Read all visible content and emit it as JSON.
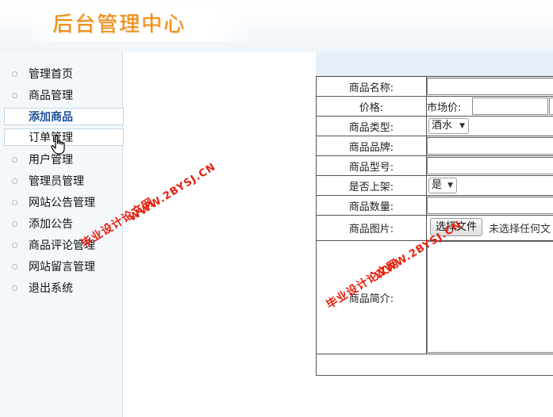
{
  "header": {
    "title": "后台管理中心"
  },
  "sidebar": {
    "items": [
      {
        "label": "管理首页"
      },
      {
        "label": "商品管理"
      },
      {
        "label": "添加商品"
      },
      {
        "label": "订单管理"
      },
      {
        "label": "用户管理"
      },
      {
        "label": "管理员管理"
      },
      {
        "label": "网站公告管理"
      },
      {
        "label": "添加公告"
      },
      {
        "label": "商品评论管理"
      },
      {
        "label": "网站留言管理"
      },
      {
        "label": "退出系统"
      }
    ]
  },
  "form": {
    "name_label": "商品名称:",
    "price_label": "价格:",
    "market_price_label": "市场价:",
    "type_label": "商品类型:",
    "type_value": "酒水",
    "brand_label": "商品品牌:",
    "model_label": "商品型号:",
    "on_shelf_label": "是否上架:",
    "on_shelf_value": "是",
    "quantity_label": "商品数量:",
    "image_label": "商品图片:",
    "file_button": "选择文件",
    "file_status": "未选择任何文",
    "intro_label": "商品简介:"
  },
  "watermark": {
    "line1": "毕业设计论文网",
    "line2": "WWW.2BYSJ.CN"
  },
  "colors": {
    "title": "#ef8e1b",
    "watermark": "#e8200e",
    "sidebar_bg": "#f4f8fc",
    "active_link": "#1d4f9a"
  }
}
